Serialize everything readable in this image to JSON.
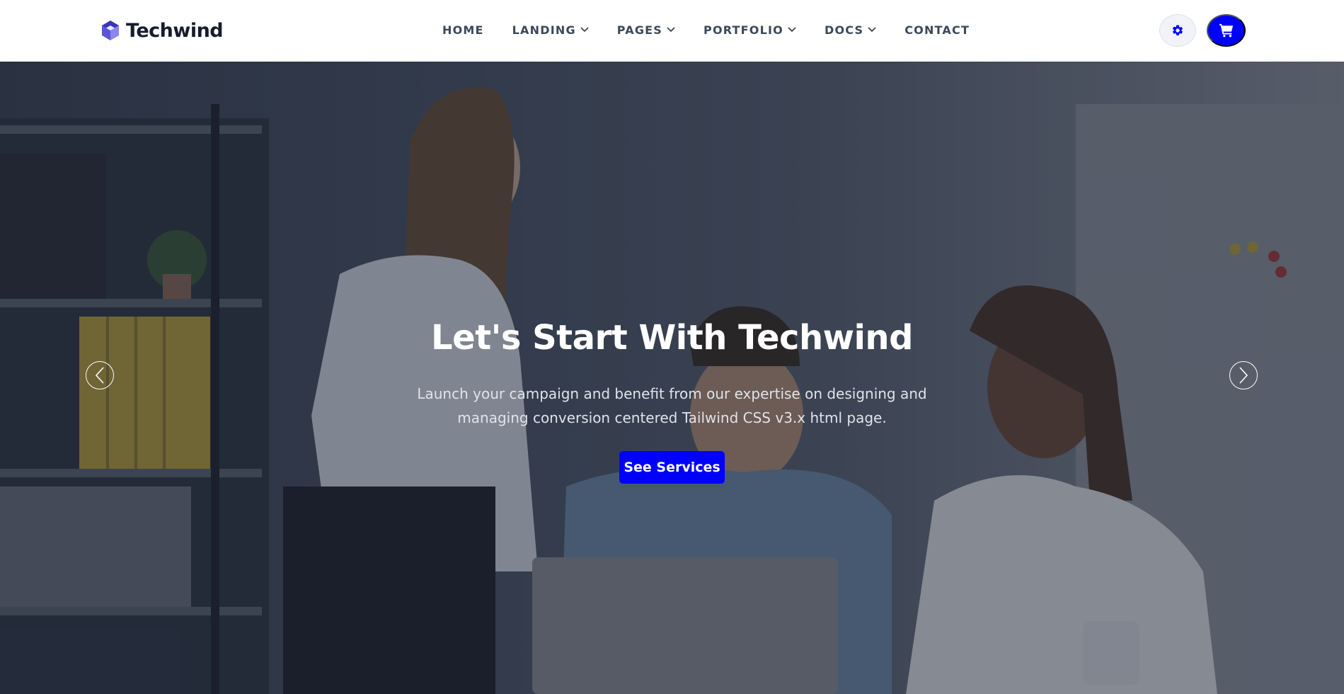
{
  "brand": {
    "name": "Techwind",
    "color": "#3b36b8"
  },
  "nav": {
    "items": [
      {
        "label": "HOME",
        "dropdown": false
      },
      {
        "label": "LANDING",
        "dropdown": true
      },
      {
        "label": "PAGES",
        "dropdown": true
      },
      {
        "label": "PORTFOLIO",
        "dropdown": true
      },
      {
        "label": "DOCS",
        "dropdown": true
      },
      {
        "label": "CONTACT",
        "dropdown": false
      }
    ]
  },
  "actions": {
    "settings_icon": "gear-icon",
    "cart_icon": "shopping-cart-icon",
    "accent_color": "#0000ff"
  },
  "hero": {
    "title": "Let's Start With Techwind",
    "description": "Launch your campaign and benefit from our expertise on designing and managing conversion centered Tailwind CSS v3.x html page.",
    "cta_label": "See Services",
    "prev_icon": "chevron-left-icon",
    "next_icon": "chevron-right-icon"
  }
}
